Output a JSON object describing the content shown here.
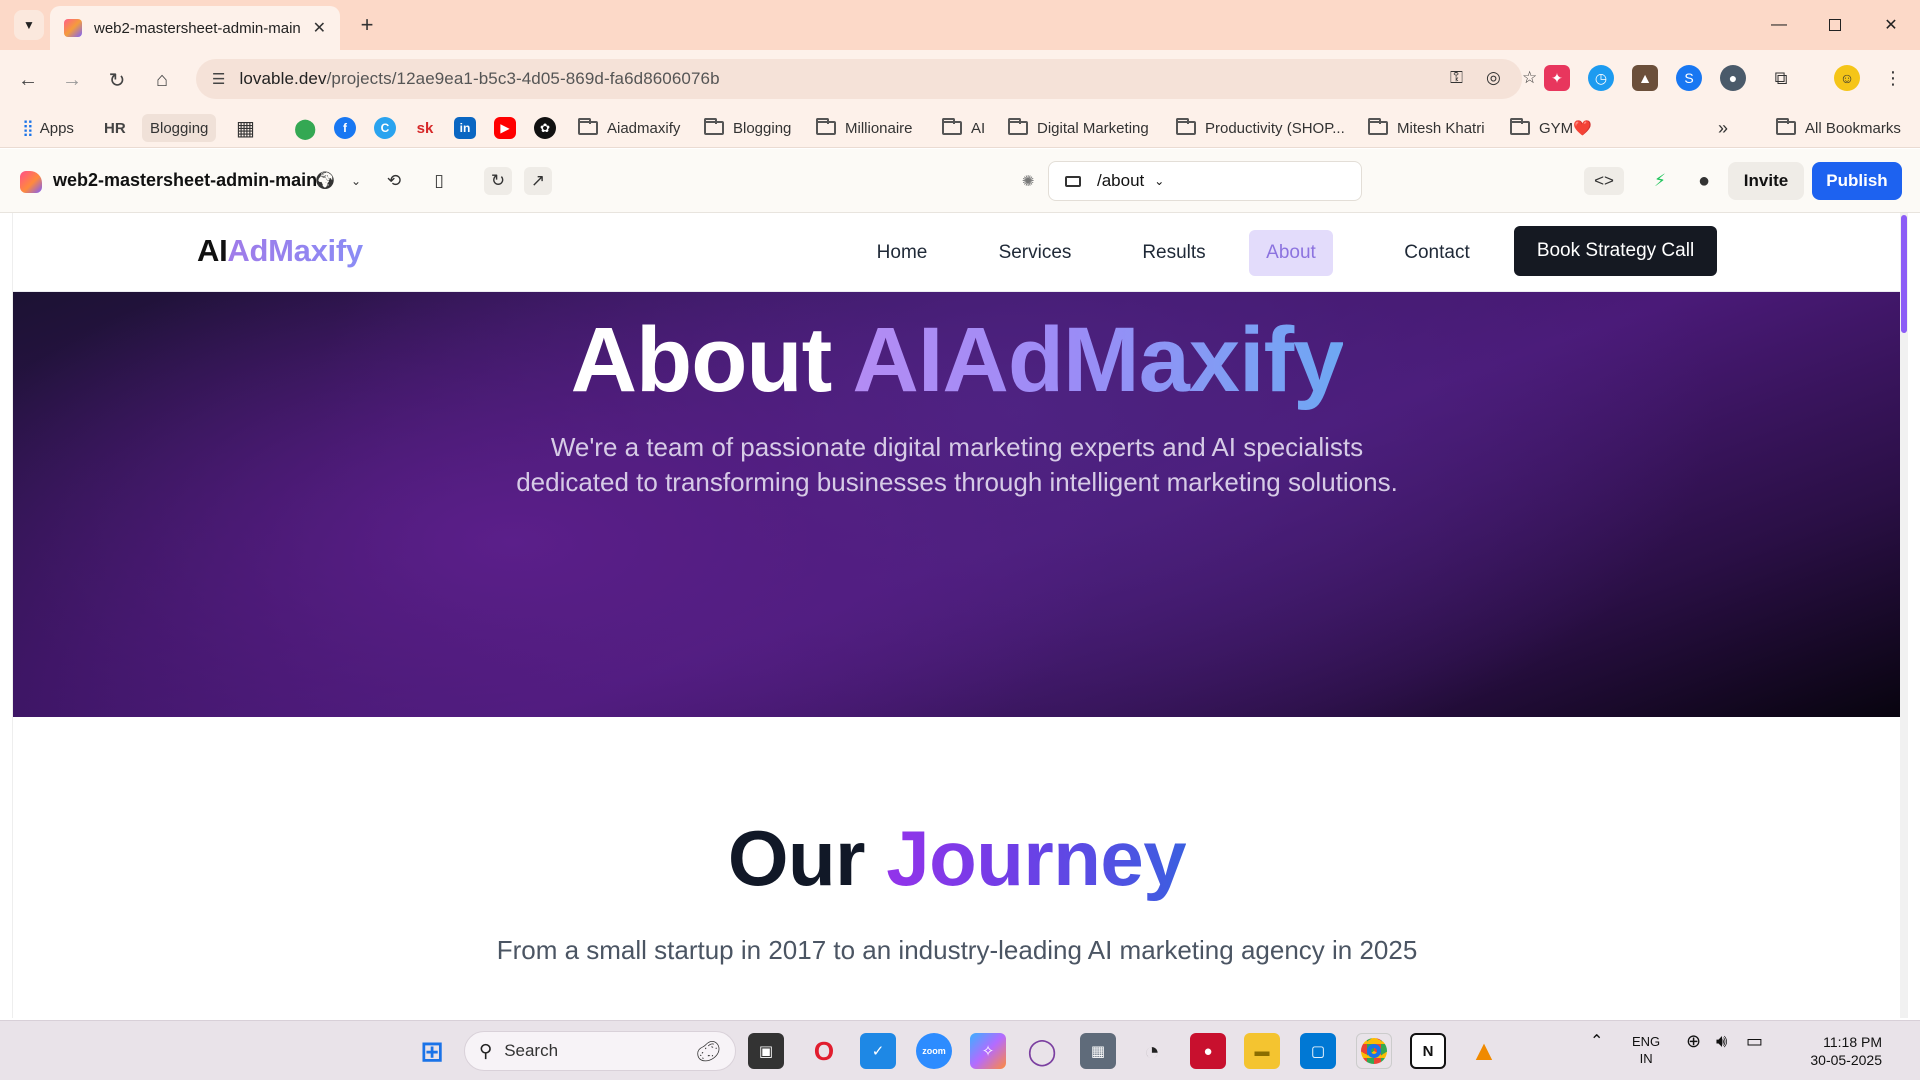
{
  "browser": {
    "tab_title": "web2-mastersheet-admin-main",
    "url_domain": "lovable.dev",
    "url_path": "/projects/12ae9ea1-b5c3-4d05-869d-fa6d8606076b",
    "new_tab_symbol": "+",
    "close_symbol": "✕"
  },
  "bookmarks": {
    "apps": "Apps",
    "hr": "HR",
    "blogging_chip": "Blogging",
    "sk": "sk",
    "folders": [
      "Aiadmaxify",
      "Blogging",
      "Millionaire",
      "AI",
      "Digital Marketing",
      "Productivity (SHOP...",
      "Mitesh Khatri",
      "GYM❤️"
    ],
    "more": "»",
    "all_bookmarks": "All Bookmarks"
  },
  "lovable": {
    "project_name": "web2-mastersheet-admin-main",
    "route": "/about",
    "invite": "Invite",
    "publish": "Publish"
  },
  "site": {
    "brand_prefix": "AI",
    "brand_suffix": "AdMaxify",
    "nav": [
      "Home",
      "Services",
      "Results",
      "About",
      "Contact"
    ],
    "active_nav": "About",
    "cta": "Book Strategy Call",
    "hero_title_plain": "About ",
    "hero_title_accent": "AIAdMaxify",
    "hero_subtitle": "We're a team of passionate digital marketing experts and AI specialists dedicated to transforming businesses through intelligent marketing solutions.",
    "journey_title_plain": "Our ",
    "journey_title_accent": "Journey",
    "journey_subtitle": "From a small startup in 2017 to an industry-leading AI marketing agency in 2025"
  },
  "taskbar": {
    "search": "Search",
    "lang": "ENG",
    "region": "IN",
    "time": "11:18 PM",
    "date": "30-05-2025"
  },
  "colors": {
    "publish": "#1d62f0",
    "cta": "#151922",
    "active_nav_bg": "#e3dcfb",
    "accent": "#8b5cf6"
  }
}
